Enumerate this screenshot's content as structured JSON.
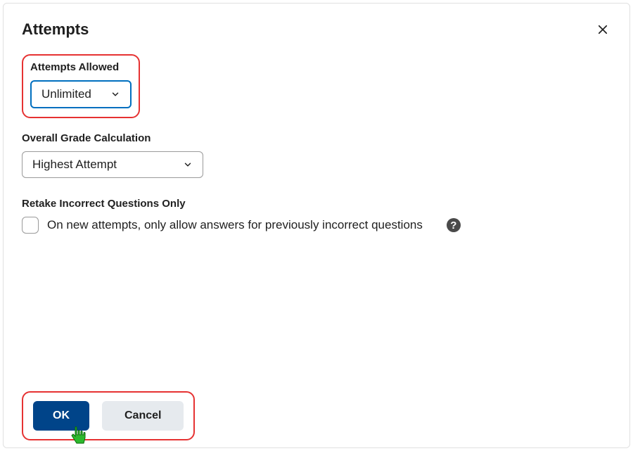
{
  "header": {
    "title": "Attempts"
  },
  "attemptsAllowed": {
    "label": "Attempts Allowed",
    "selected": "Unlimited"
  },
  "gradeCalculation": {
    "label": "Overall Grade Calculation",
    "selected": "Highest Attempt"
  },
  "retake": {
    "label": "Retake Incorrect Questions Only",
    "checkboxLabel": "On new attempts, only allow answers for previously incorrect questions",
    "checked": false
  },
  "footer": {
    "okLabel": "OK",
    "cancelLabel": "Cancel"
  },
  "helpIconChar": "?"
}
